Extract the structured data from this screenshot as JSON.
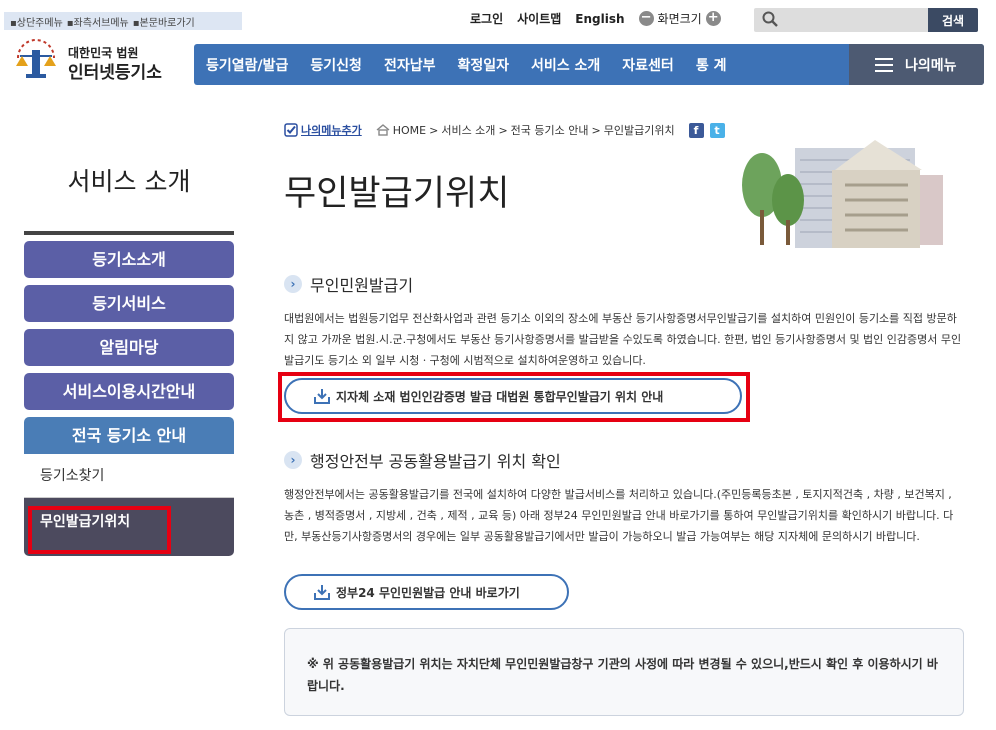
{
  "skip_links": [
    "▪상단주메뉴",
    "▪좌측서브메뉴",
    "▪본문바로가기"
  ],
  "util": {
    "login": "로그인",
    "sitemap": "사이트맵",
    "english": "English",
    "zoom_label": "화면크기",
    "zoom_out": "−",
    "zoom_in": "+"
  },
  "search": {
    "placeholder": "",
    "button": "검색"
  },
  "logo": {
    "line1": "대한민국 법원",
    "line2": "인터넷등기소"
  },
  "gnb": [
    "등기열람/발급",
    "등기신청",
    "전자납부",
    "확정일자",
    "서비스 소개",
    "자료센터",
    "통 계"
  ],
  "my_menu": "나의메뉴",
  "sidebar": {
    "title": "서비스 소개",
    "items": [
      {
        "label": "등기소소개"
      },
      {
        "label": "등기서비스"
      },
      {
        "label": "알림마당"
      },
      {
        "label": "서비스이용시간안내"
      },
      {
        "label": "전국 등기소 안내"
      }
    ],
    "sub": [
      "등기소찾기",
      "무인발급기위치"
    ]
  },
  "breadcrumb": {
    "add": "나의메뉴추가",
    "home": "HOME",
    "sep": ">",
    "path": [
      "서비스 소개",
      "전국 등기소 안내",
      "무인발급기위치"
    ],
    "fb": "f",
    "tw": "t"
  },
  "page_title": "무인발급기위치",
  "section1": {
    "title": "무인민원발급기",
    "text": "대법원에서는 법원등기업무 전산화사업과 관련 등기소 이외의 장소에 부동산 등기사항증명서무인발급기를 설치하여 민원인이 등기소를 직접 방문하지 않고 가까운 법원.시.군.구청에서도 부동산 등기사항증명서를 발급받을 수있도록 하였습니다. 한편, 법인 등기사항증명서 및 법인 인감증명서 무인발급기도 등기소 외 일부 시청ㆍ구청에 시범적으로 설치하여운영하고 있습니다.",
    "button": "지자체 소재 법인인감증명 발급 대법원 통합무인발급기 위치 안내"
  },
  "section2": {
    "title": "행정안전부 공동활용발급기 위치 확인",
    "text": "행정안전부에서는 공동활용발급기를 전국에 설치하여 다양한 발급서비스를 처리하고 있습니다.(주민등록등초본 , 토지지적건축 , 차량 , 보건복지 , 농촌 , 병적증명서 , 지방세 , 건축 , 제적 , 교육 등) 아래 정부24 무인민원발급 안내 바로가기를 통하여 무인발급기위치를 확인하시기 바랍니다. 다만, 부동산등기사항증명서의 경우에는 일부 공동활용발급기에서만 발급이 가능하오니 발급 가능여부는 해당 지자체에 문의하시기 바랍니다.",
    "button": "정부24 무인민원발급 안내 바로가기"
  },
  "notice": "※ 위 공동활용발급기 위치는 자치단체 무인민원발급창구 기관의 사정에 따라 변경될 수 있으니,반드시 확인 후 이용하시기 바랍니다.",
  "colors": {
    "gnb": "#3d72b6",
    "sidebar": "#5b5fa6",
    "sidebar_active": "#4a7db6",
    "highlight": "#e60012"
  }
}
